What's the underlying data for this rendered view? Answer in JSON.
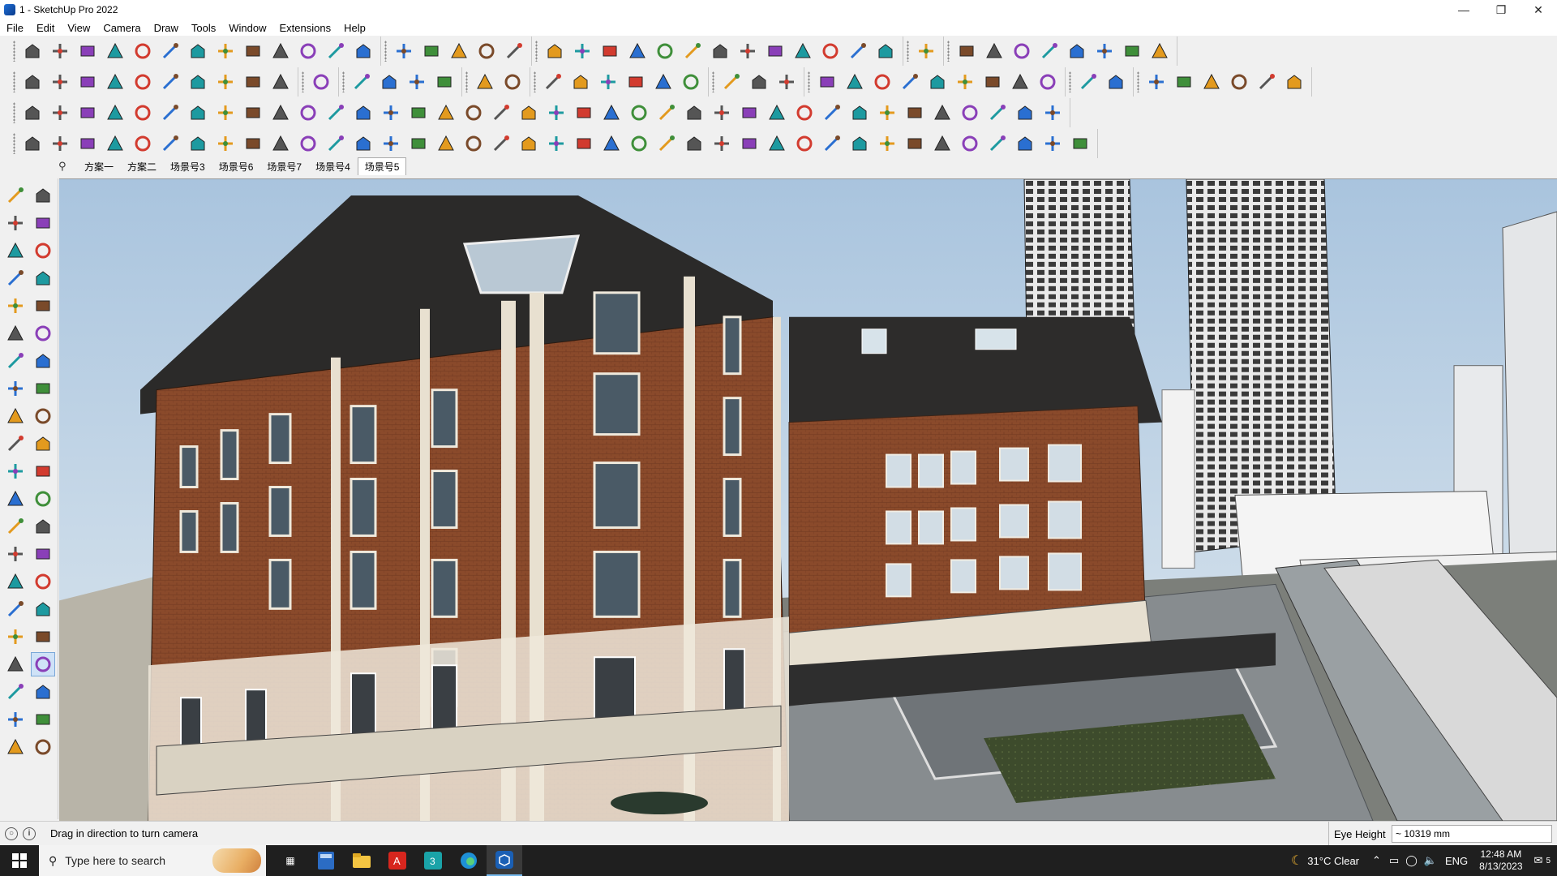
{
  "window": {
    "title": "1 - SketchUp Pro 2022",
    "controls": [
      "minimize-icon",
      "restore-icon",
      "close-icon"
    ]
  },
  "menubar": [
    "File",
    "Edit",
    "View",
    "Camera",
    "Draw",
    "Tools",
    "Window",
    "Extensions",
    "Help"
  ],
  "toolbars": {
    "row1_groups": [
      13,
      5,
      13,
      1,
      8
    ],
    "row2_groups": [
      10,
      1,
      4,
      2,
      6,
      3,
      9,
      2,
      6
    ],
    "row3_groups": [
      38
    ],
    "row4_groups": [
      39
    ]
  },
  "scenes": {
    "search_icon": "search-icon",
    "tabs": [
      "方案一",
      "方案二",
      "场景号3",
      "场景号6",
      "场景号7",
      "场景号4",
      "场景号5"
    ],
    "active_index": 6
  },
  "left_toolbar": {
    "icons": [
      "select-icon",
      "orbit-icon",
      "paint-bucket-icon",
      "eraser-icon",
      "component-icon",
      "tape-measure-icon",
      "line-icon",
      "freehand-icon",
      "rectangle-icon",
      "rotated-rectangle-icon",
      "circle-icon",
      "polygon-icon",
      "arc-icon",
      "pie-icon",
      "two-point-arc-icon",
      "three-point-arc-icon",
      "move-icon",
      "push-pull-icon",
      "rotate-icon",
      "follow-me-icon",
      "scale-icon",
      "offset-icon",
      "tape-icon",
      "dimension-icon",
      "protractor-icon",
      "text-icon",
      "axes-icon",
      "3d-text-icon",
      "orbit-tool-icon",
      "pan-icon",
      "zoom-icon",
      "zoom-window-icon",
      "zoom-extents-icon",
      "previous-view-icon",
      "position-camera-icon",
      "look-around-icon",
      "walk-icon",
      "section-plane-icon",
      "display-section-icon",
      "section-cuts-icon",
      "section-fill-icon",
      "layers-icon"
    ],
    "active_icon": "look-around-icon"
  },
  "status": {
    "message": "Drag in direction to turn camera",
    "vcb_label": "Eye Height",
    "vcb_value": "~ 10319 mm"
  },
  "taskbar": {
    "search_placeholder": "Type here to search",
    "weather": "31°C  Clear",
    "language": "ENG",
    "time": "12:48 AM",
    "date": "8/13/2023",
    "notification_count": "5"
  },
  "colors": {
    "brick": "#8a4a2b",
    "roof": "#2d2c2b",
    "sky": "#b6cde2",
    "trim": "#e8e0d0",
    "accent_blue": "#1f6fd6"
  }
}
